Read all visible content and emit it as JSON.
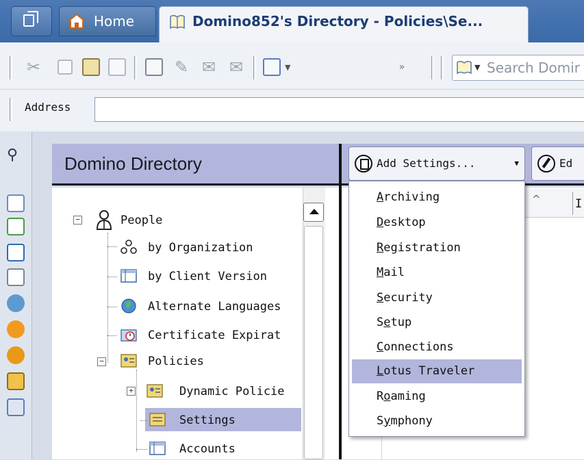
{
  "tabs": {
    "home_label": "Home",
    "active_label": "Domino852's Directory - Policies\\Se..."
  },
  "toolbar": {
    "search_placeholder": "Search Domir"
  },
  "address": {
    "label": "Address",
    "value": ""
  },
  "navigator": {
    "title": "Domino Directory",
    "people": "People",
    "by_organization": "by Organization",
    "by_client_version": "by Client Version",
    "alternate_languages": "Alternate Languages",
    "certificate_expiration": "Certificate Expirat",
    "policies": "Policies",
    "dynamic_policies": "Dynamic Policie",
    "settings": "Settings",
    "accounts": "Accounts"
  },
  "view": {
    "add_settings_label": "Add Settings...",
    "edit_label": "Ed",
    "column_header_partial": "I"
  },
  "menu": {
    "items": [
      {
        "mnemonic": "A",
        "rest": "rchiving"
      },
      {
        "mnemonic": "D",
        "rest": "esktop"
      },
      {
        "mnemonic": "R",
        "rest": "egistration"
      },
      {
        "mnemonic": "M",
        "rest": "ail"
      },
      {
        "mnemonic": "S",
        "rest": "ecurity"
      },
      {
        "pre": "S",
        "mnemonic": "e",
        "rest": "tup"
      },
      {
        "mnemonic": "C",
        "rest": "onnections"
      },
      {
        "mnemonic": "L",
        "rest": "otus Traveler"
      },
      {
        "pre": "R",
        "mnemonic": "o",
        "rest": "aming"
      },
      {
        "pre": "S",
        "mnemonic": "y",
        "rest": "mphony"
      }
    ],
    "highlighted": "Lotus Traveler"
  },
  "colors": {
    "header_lavender": "#b2b6dc",
    "tabbar_blue": "#3a6aa9",
    "highlight": "#b2b6dc"
  }
}
